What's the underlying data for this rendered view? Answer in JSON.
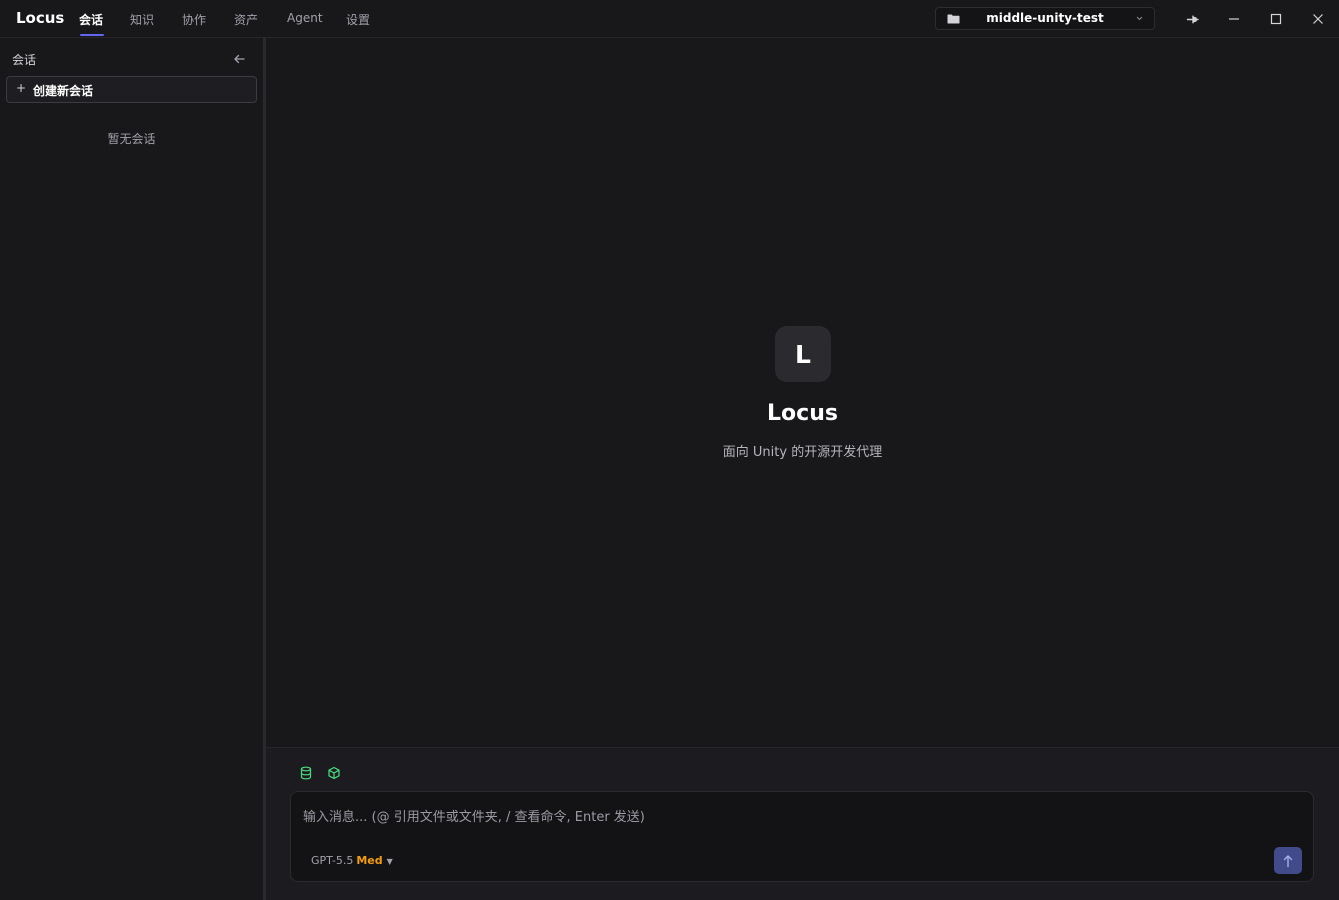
{
  "app": {
    "name": "Locus"
  },
  "nav": {
    "tabs": [
      {
        "label": "会话",
        "active": true
      },
      {
        "label": "知识",
        "active": false
      },
      {
        "label": "协作",
        "active": false
      },
      {
        "label": "资产",
        "active": false
      },
      {
        "label": "Agent",
        "active": false
      },
      {
        "label": "设置",
        "active": false
      }
    ]
  },
  "project": {
    "name": "middle-unity-test",
    "icon": "folder-icon"
  },
  "window_controls": [
    "pin-icon",
    "minimize-icon",
    "maximize-icon",
    "close-icon"
  ],
  "sidebar": {
    "title": "会话",
    "new_chat_label": "创建新会话",
    "new_chat_icon": "+",
    "empty_text": "暂无会话"
  },
  "hero": {
    "logo_letter": "L",
    "title": "Locus",
    "subtitle": "面向 Unity 的开源开发代理"
  },
  "composer": {
    "placeholder": "输入消息... (@ 引用文件或文件夹, / 查看命令, Enter 发送)",
    "context_icons": [
      "database-icon",
      "cube-icon"
    ],
    "model": "GPT-5.5",
    "effort": "Med",
    "send_icon": "arrow-up-icon"
  },
  "colors": {
    "background": "#18181b",
    "accent": "#6366f1",
    "effort": "#f59e0b",
    "context_icon": "#4ade80",
    "send_button": "#414a8a"
  }
}
